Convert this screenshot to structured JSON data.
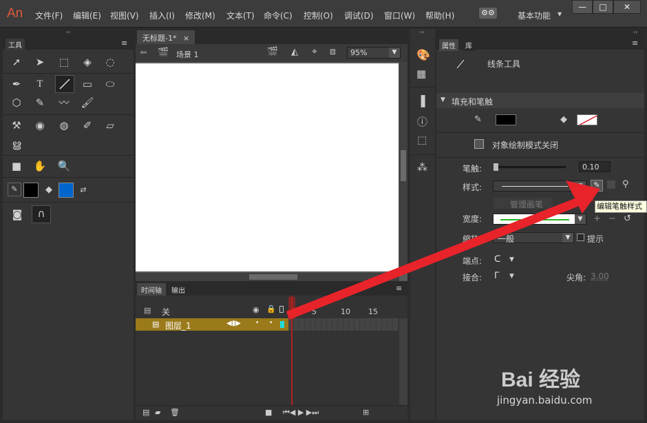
{
  "app": {
    "logo": "An"
  },
  "menu": [
    "文件(F)",
    "编辑(E)",
    "视图(V)",
    "插入(I)",
    "修改(M)",
    "文本(T)",
    "命令(C)",
    "控制(O)",
    "调试(D)",
    "窗口(W)",
    "帮助(H)"
  ],
  "workspace": {
    "label": "基本功能",
    "gear": "⚙⚙"
  },
  "window_controls": {
    "minimize": "—",
    "maximize": "□",
    "close": "✕"
  },
  "tools_panel": {
    "tab": "工具"
  },
  "document": {
    "tab": "无标题-1*",
    "tab_close": "×",
    "scene": "场景 1",
    "zoom": "95%"
  },
  "timeline": {
    "tabs": [
      "时间轴",
      "输出"
    ],
    "folder_layer": "关",
    "layer_name": "图层_1",
    "frame_numbers": [
      "1",
      "5",
      "10",
      "15"
    ]
  },
  "properties": {
    "tabs": [
      "属性",
      "库"
    ],
    "tool_name": "线条工具",
    "section": "填充和笔触",
    "object_draw_mode": "对象绘制模式关闭",
    "stroke_label": "笔触:",
    "stroke_value": "0.10",
    "style_label": "样式:",
    "manage_brush": "管理画笔",
    "width_label": "宽度:",
    "scale_label": "缩放:",
    "scale_value": "一般",
    "hint_label": "提示",
    "cap_label": "端点:",
    "join_label": "接合:",
    "miter_label": "尖角:",
    "miter_value": "3.00",
    "tooltip": "编辑笔触样式"
  },
  "watermark": {
    "brand": "Bai 经验",
    "url": "jingyan.baidu.com"
  },
  "colors": {
    "accent_arrow": "#e8232a",
    "layer_bar": "#9a7a1a",
    "playhead": "#b02020",
    "fill_swatch": "#0066cc"
  }
}
